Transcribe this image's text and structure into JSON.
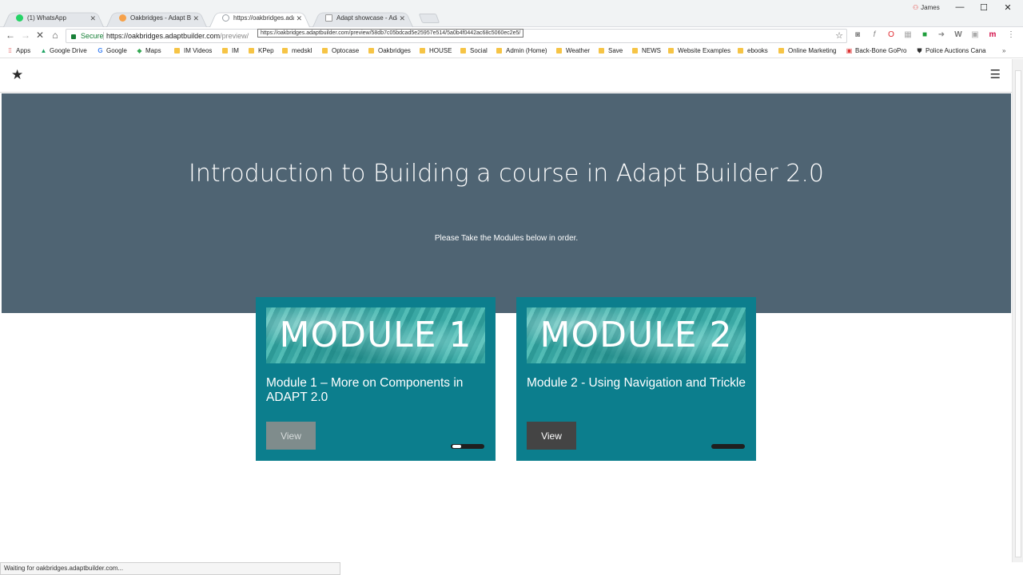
{
  "browser": {
    "tabs": [
      {
        "title": "(1) WhatsApp",
        "fav_color": "#25d366",
        "active": false
      },
      {
        "title": "Oakbridges - Adapt Builder",
        "fav_color": "#f6a14a",
        "active": false
      },
      {
        "title": "https://oakbridges.adaptbuilder.com",
        "fav_color": "#9aa0a6",
        "active": true
      },
      {
        "title": "Adapt showcase - Adapt",
        "fav_color": "#bbbbbb",
        "active": false
      }
    ],
    "profile_name": "James",
    "secure_label": "Secure",
    "url_main": "https://oakbridges.adaptbuilder.com",
    "url_rest": "/preview/",
    "link_tooltip": "https://oakbridges.adaptbuilder.com/preview/58db7c05bdcad5e25957e514/5a0b4f0442ac68c5060ec2e5/",
    "status_text": "Waiting for oakbridges.adaptbuilder.com..."
  },
  "bookmarks": [
    {
      "label": "Apps",
      "icon": "apps-icon"
    },
    {
      "label": "Google Drive",
      "icon": "drive-icon"
    },
    {
      "label": "Google",
      "icon": "google-icon"
    },
    {
      "label": "Maps",
      "icon": "maps-icon"
    },
    {
      "label": "IM Videos",
      "icon": "folder-icon"
    },
    {
      "label": "IM",
      "icon": "folder-icon"
    },
    {
      "label": "KPep",
      "icon": "folder-icon"
    },
    {
      "label": "medskl",
      "icon": "folder-icon"
    },
    {
      "label": "Optocase",
      "icon": "folder-icon"
    },
    {
      "label": "Oakbridges",
      "icon": "folder-icon"
    },
    {
      "label": "HOUSE",
      "icon": "folder-icon"
    },
    {
      "label": "Social",
      "icon": "folder-icon"
    },
    {
      "label": "Admin (Home)",
      "icon": "folder-icon"
    },
    {
      "label": "Weather",
      "icon": "folder-icon"
    },
    {
      "label": "Save",
      "icon": "folder-icon"
    },
    {
      "label": "NEWS",
      "icon": "folder-icon"
    },
    {
      "label": "Website Examples",
      "icon": "folder-icon"
    },
    {
      "label": "ebooks",
      "icon": "folder-icon"
    },
    {
      "label": "Online Marketing",
      "icon": "folder-icon"
    },
    {
      "label": "Back-Bone  GoPro",
      "icon": "bookmark-icon"
    },
    {
      "label": "Police Auctions Cana",
      "icon": "shield-icon"
    }
  ],
  "course": {
    "title": "Introduction to Building a course in Adapt Builder 2.0",
    "subtitle": "Please Take the Modules below in order.",
    "modules": [
      {
        "banner": "MODULE 1",
        "title": "Module 1 – More on Components in ADAPT 2.0",
        "view_label": "View",
        "progress": 0.3
      },
      {
        "banner": "MODULE 2",
        "title": "Module 2 - Using Navigation and Trickle",
        "view_label": "View",
        "progress": 0
      }
    ]
  },
  "colors": {
    "hero_bg": "#4f6473",
    "card_bg": "#0c7e8d",
    "view_button": "#444444"
  }
}
